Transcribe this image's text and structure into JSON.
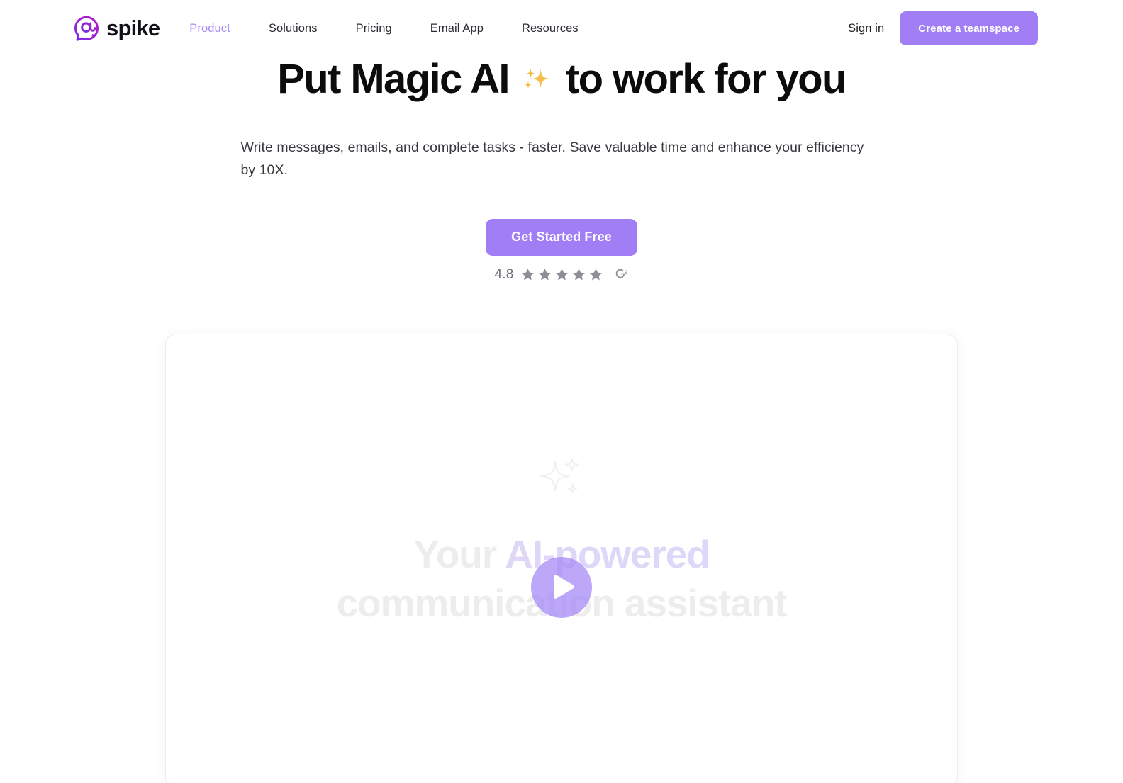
{
  "header": {
    "brand": {
      "name": "spike",
      "logo_icon": "spike-at-bubble-icon",
      "logo_gradient_from": "#A51FD0",
      "logo_gradient_to": "#5F2BEE"
    },
    "nav": [
      {
        "label": "Product",
        "active": true
      },
      {
        "label": "Solutions",
        "active": false
      },
      {
        "label": "Pricing",
        "active": false
      },
      {
        "label": "Email App",
        "active": false
      },
      {
        "label": "Resources",
        "active": false
      }
    ],
    "signin_label": "Sign in",
    "cta_label": "Create a teamspace",
    "cta_color": "#A17EF5",
    "active_nav_color": "#A78BF5"
  },
  "hero": {
    "title_before": "Put Magic AI",
    "title_emoji": "sparkles-emoji",
    "title_after": "to work for you",
    "subtitle": "Write messages, emails, and complete tasks - faster. Save valuable time and enhance your efficiency by 10X.",
    "cta_label": "Get Started Free",
    "cta_color": "#A17EF5",
    "emoji_color": "#F5BE47",
    "rating": {
      "score": "4.8",
      "stars_filled": 5,
      "star_color": "#8E8E96",
      "source_icon": "g2-logo-icon",
      "source_name": "G2"
    }
  },
  "video_card": {
    "placeholder_icon": "sparkle-outline-icon",
    "headline_line1_plain": "Your ",
    "headline_line1_accent": "AI-powered",
    "headline_line2": "communication assistant",
    "headline_plain_color": "#EDEDEE",
    "headline_accent_color": "#DED7F7",
    "play_button_icon": "play-icon",
    "play_button_color": "rgba(164,133,246,0.72)"
  }
}
